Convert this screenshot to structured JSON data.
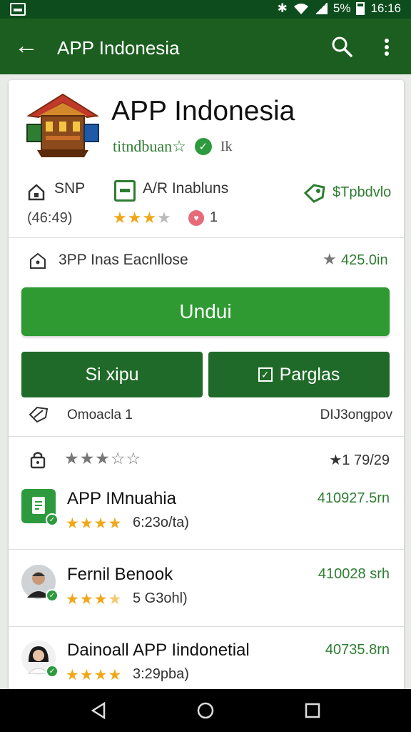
{
  "status_bar": {
    "battery": "5%",
    "time": "16:16"
  },
  "app_bar": {
    "title": "APP Indonesia",
    "back_icon": "arrow-back-icon",
    "search_icon": "search-icon",
    "more_icon": "more-vert-icon"
  },
  "app": {
    "name": "APP Indonesia",
    "developer": "titndbuan☆",
    "developer_extra": "Ik",
    "meta_left_top": "SNP",
    "meta_left_bottom": "(46:49)",
    "meta_mid_label": "A/R Inabluns",
    "rating_value": "1",
    "meta_right": "$Tpbdvlo"
  },
  "info_row": {
    "text": "3PP Inas Eacnllose",
    "value": "425.0in"
  },
  "buttons": {
    "primary": "Undui",
    "left": "Si xipu",
    "right": "Parglas"
  },
  "tag_row": {
    "left": "Omoacla 1",
    "right": "DIJ3ongpov"
  },
  "reviews_header": {
    "value": "1 79/29"
  },
  "reviews": [
    {
      "name": "APP IMnuahia",
      "sub": "6:23o/ta)",
      "amount": "410927.5rn"
    },
    {
      "name": "Fernil Benook",
      "sub": "5 G3ohl)",
      "amount": "410028 srh"
    },
    {
      "name": "Dainoall APP Iindonetial",
      "sub": "3:29pba)",
      "amount": "40735.8rn"
    }
  ],
  "colors": {
    "app_bar": "#1b5e20",
    "status_bar": "#0d4d1d",
    "primary_button": "#2e9a31",
    "secondary_button": "#1f6a28",
    "accent": "#2e7d32",
    "star": "#f0a81a"
  }
}
